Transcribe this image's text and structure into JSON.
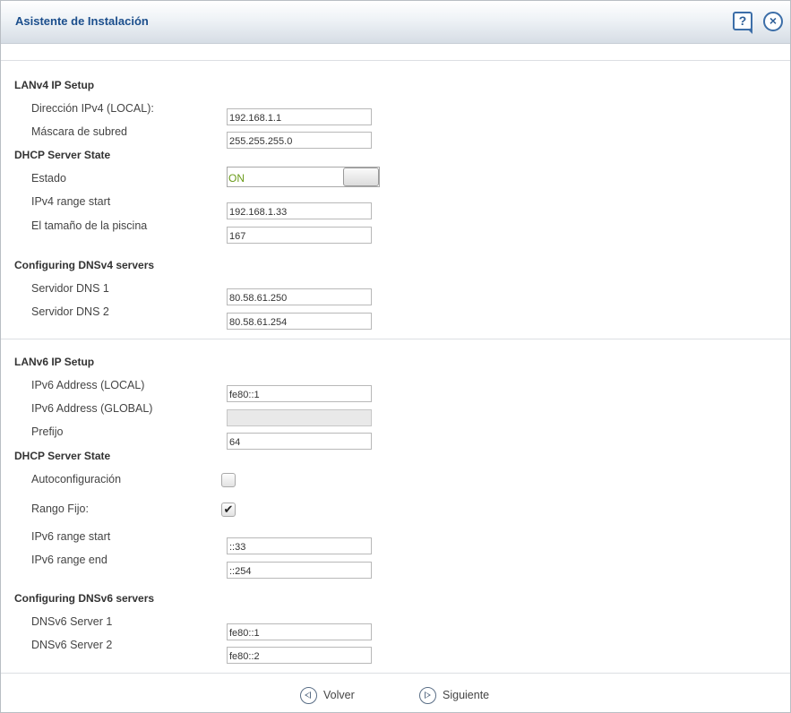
{
  "window": {
    "title": "Asistente de Instalación",
    "help_icon": "help-icon",
    "close_icon": "close-icon"
  },
  "lanv4": {
    "heading": "LANv4 IP Setup",
    "ip_label": "Dirección IPv4 (LOCAL):",
    "ip_value": "192.168.1.1",
    "mask_label": "Máscara de subred",
    "mask_value": "255.255.255.0"
  },
  "dhcp4": {
    "heading": "DHCP Server State",
    "state_label": "Estado",
    "state_value": "ON",
    "range_start_label": "IPv4 range start",
    "range_start_value": "192.168.1.33",
    "pool_size_label": "El tamaño de la piscina",
    "pool_size_value": "167"
  },
  "dns4": {
    "heading": "Configuring DNSv4 servers",
    "server1_label": "Servidor DNS 1",
    "server1_value": "80.58.61.250",
    "server2_label": "Servidor DNS 2",
    "server2_value": "80.58.61.254"
  },
  "lanv6": {
    "heading": "LANv6 IP Setup",
    "local_label": "IPv6 Address (LOCAL)",
    "local_value": "fe80::1",
    "global_label": "IPv6 Address (GLOBAL)",
    "global_value": "",
    "prefix_label": "Prefijo",
    "prefix_value": "64"
  },
  "dhcp6": {
    "heading": "DHCP Server State",
    "autoconfig_label": "Autoconfiguración",
    "autoconfig_checked": false,
    "fixed_range_label": "Rango Fijo:",
    "fixed_range_checked": true,
    "range_start_label": "IPv6 range start",
    "range_start_value": "::33",
    "range_end_label": "IPv6 range end",
    "range_end_value": "::254"
  },
  "dns6": {
    "heading": "Configuring DNSv6 servers",
    "server1_label": "DNSv6 Server 1",
    "server1_value": "fe80::1",
    "server2_label": "DNSv6 Server 2",
    "server2_value": "fe80::2"
  },
  "footer": {
    "back_label": "Volver",
    "next_label": "Siguiente"
  },
  "colors": {
    "title": "#1b4e8c",
    "toggle_on_text": "#6a9b19",
    "icon_blue": "#3c6ea8"
  }
}
